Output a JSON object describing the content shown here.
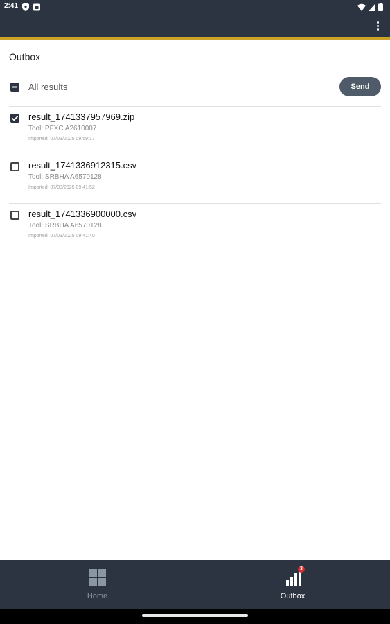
{
  "status_bar": {
    "time": "2:41",
    "left_icons": [
      "shield-icon",
      "notification-icon"
    ],
    "right_icons": [
      "wifi-icon",
      "signal-icon",
      "battery-icon"
    ]
  },
  "app_bar": {
    "menu_icon": "more-vert-icon",
    "accent_color": "#c9a227",
    "background": "#2b3440"
  },
  "outbox": {
    "title": "Outbox",
    "select_all_label": "All results",
    "select_all_state": "indeterminate",
    "send_label": "Send",
    "items": [
      {
        "name": "result_1741337957969.zip",
        "tool": "Tool: PFXC A2610007",
        "imported": "Imported: 07/03/2025 09:59:17",
        "checked": true
      },
      {
        "name": "result_1741336912315.csv",
        "tool": "Tool: SRBHA A6570128",
        "imported": "Imported: 07/03/2025 09:41:52",
        "checked": false
      },
      {
        "name": "result_1741336900000.csv",
        "tool": "Tool: SRBHA A6570128",
        "imported": "Imported: 07/03/2025 09:41:40",
        "checked": false
      }
    ]
  },
  "bottom_nav": {
    "items": [
      {
        "label": "Home",
        "icon": "grid-icon",
        "active": false
      },
      {
        "label": "Outbox",
        "icon": "bar-chart-icon",
        "active": true,
        "badge": "3"
      }
    ]
  }
}
